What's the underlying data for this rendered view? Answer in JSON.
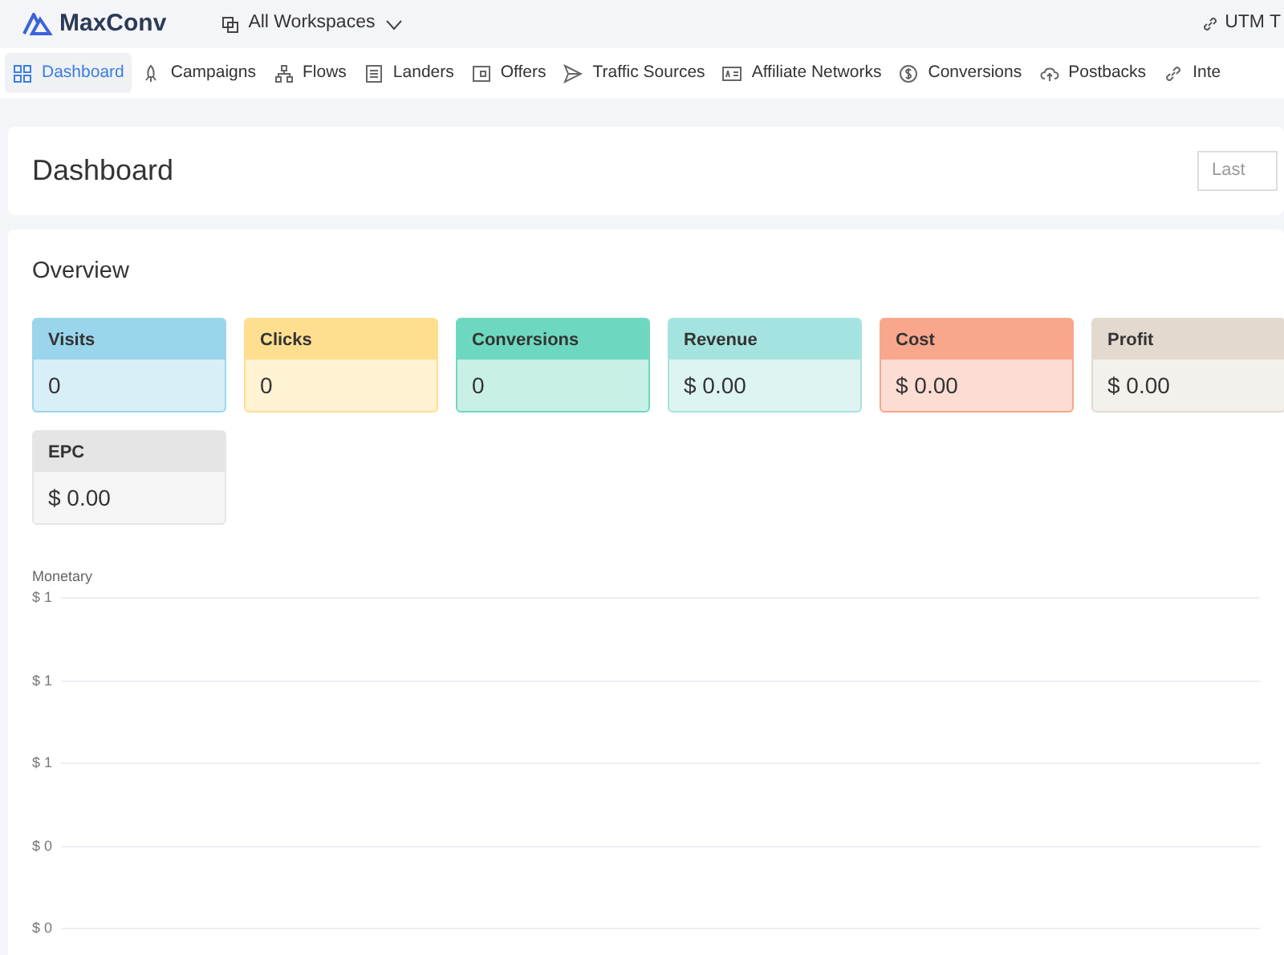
{
  "brand": "MaxConv",
  "workspace": {
    "label": "All Workspaces"
  },
  "top_link": {
    "label": "UTM T"
  },
  "nav": [
    {
      "label": "Dashboard",
      "selected": true
    },
    {
      "label": "Campaigns",
      "selected": false
    },
    {
      "label": "Flows",
      "selected": false
    },
    {
      "label": "Landers",
      "selected": false
    },
    {
      "label": "Offers",
      "selected": false
    },
    {
      "label": "Traffic Sources",
      "selected": false
    },
    {
      "label": "Affiliate Networks",
      "selected": false
    },
    {
      "label": "Conversions",
      "selected": false
    },
    {
      "label": "Postbacks",
      "selected": false
    },
    {
      "label": "Inte",
      "selected": false
    }
  ],
  "page_title": "Dashboard",
  "date_range": {
    "placeholder": "Last"
  },
  "overview": {
    "title": "Overview",
    "metrics": [
      {
        "label": "Visits",
        "value": "0",
        "color": "#9ad5ec"
      },
      {
        "label": "Clicks",
        "value": "0",
        "color": "#fedf8f"
      },
      {
        "label": "Conversions",
        "value": "0",
        "color": "#6dd8bf"
      },
      {
        "label": "Revenue",
        "value": "$ 0.00",
        "color": "#a5e3e0"
      },
      {
        "label": "Cost",
        "value": "$ 0.00",
        "color": "#f8a68c"
      },
      {
        "label": "Profit",
        "value": "$ 0.00",
        "color": "#e2d9cf"
      },
      {
        "label": "EPC",
        "value": "$ 0.00",
        "color": "#e5e5e5"
      }
    ]
  },
  "chart": {
    "title": "Monetary",
    "y_labels": [
      "$ 1",
      "$ 1",
      "$ 1",
      "$ 0",
      "$ 0"
    ]
  }
}
